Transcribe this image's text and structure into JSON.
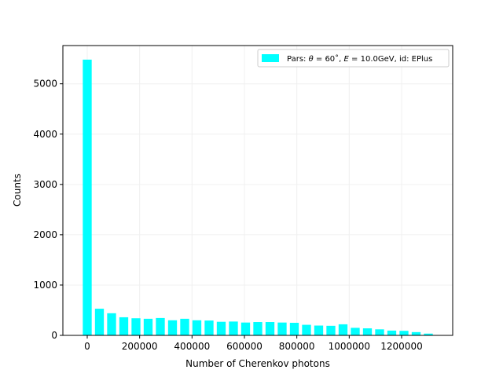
{
  "chart_data": {
    "type": "bar",
    "xlabel": "Number of Cherenkov photons",
    "ylabel": "Counts",
    "xlim": [
      -93000,
      1395000
    ],
    "ylim": [
      0,
      5760
    ],
    "grid": true,
    "legend_position": "top-right",
    "colors": {
      "bar": "#00ffff",
      "grid": "#f0f0f0",
      "axis": "#000000"
    },
    "bar_width": 34000,
    "legend": {
      "prefix": "Pars: ",
      "theta_sym": "θ",
      "theta_val": " = 60˚, ",
      "e_sym": "E",
      "e_val": " = 10.0GeV, id: EPlus"
    },
    "xticks": [
      0,
      200000,
      400000,
      600000,
      800000,
      1000000,
      1200000
    ],
    "xtick_labels": [
      "0",
      "200000",
      "400000",
      "600000",
      "800000",
      "1000000",
      "1200000"
    ],
    "yticks": [
      0,
      1000,
      2000,
      3000,
      4000,
      5000
    ],
    "ytick_labels": [
      "0",
      "1000",
      "2000",
      "3000",
      "4000",
      "5000"
    ],
    "x": [
      0,
      46500,
      93000,
      139500,
      186000,
      232500,
      279000,
      325500,
      372000,
      418500,
      465000,
      511500,
      558000,
      604500,
      651000,
      697500,
      744000,
      790500,
      837000,
      883500,
      930000,
      976500,
      1023000,
      1069500,
      1116000,
      1162500,
      1209000,
      1255500,
      1302000
    ],
    "values": [
      5480,
      530,
      440,
      360,
      340,
      330,
      345,
      300,
      330,
      300,
      295,
      270,
      275,
      255,
      265,
      265,
      255,
      250,
      210,
      195,
      190,
      220,
      150,
      140,
      120,
      95,
      90,
      65,
      35
    ]
  }
}
